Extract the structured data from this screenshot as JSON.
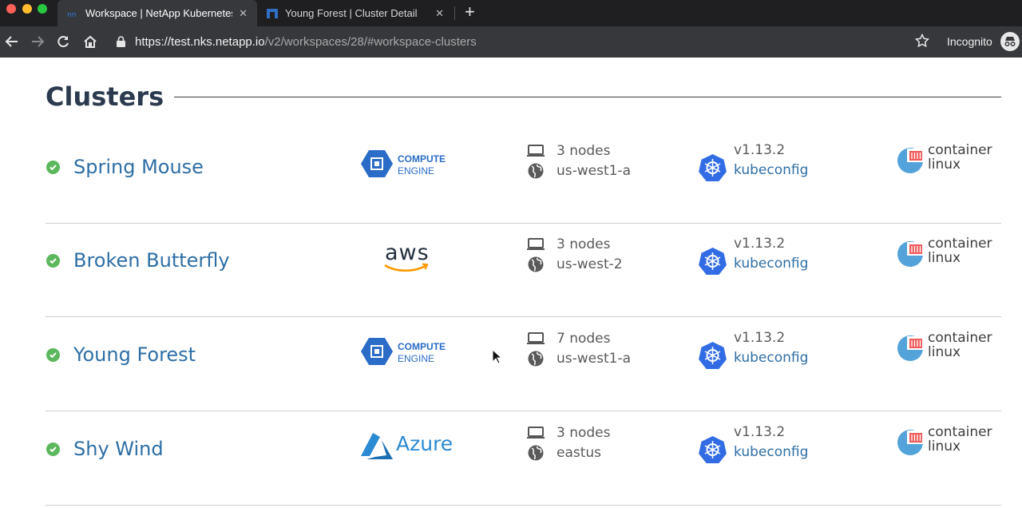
{
  "browser": {
    "tabs": [
      {
        "title": "Workspace | NetApp Kubernetes",
        "active": true
      },
      {
        "title": "Young Forest | Cluster Detail",
        "active": false
      }
    ],
    "url_host": "https://test.nks.netapp.io",
    "url_path": "/v2/workspaces/28/#workspace-clusters",
    "incognito_label": "Incognito"
  },
  "page": {
    "title": "Clusters"
  },
  "clusters": [
    {
      "name": "Spring Mouse",
      "provider": "compute-engine",
      "provider_line1": "COMPUTE",
      "provider_line2": "ENGINE",
      "nodes": "3 nodes",
      "region": "us-west1-a",
      "version": "v1.13.2",
      "kubeconfig": "kubeconfig",
      "os_line1": "container",
      "os_line2": "linux"
    },
    {
      "name": "Broken Butterfly",
      "provider": "aws",
      "provider_line1": "aws",
      "nodes": "3 nodes",
      "region": "us-west-2",
      "version": "v1.13.2",
      "kubeconfig": "kubeconfig",
      "os_line1": "container",
      "os_line2": "linux"
    },
    {
      "name": "Young Forest",
      "provider": "compute-engine",
      "provider_line1": "COMPUTE",
      "provider_line2": "ENGINE",
      "nodes": "7 nodes",
      "region": "us-west1-a",
      "version": "v1.13.2",
      "kubeconfig": "kubeconfig",
      "os_line1": "container",
      "os_line2": "linux"
    },
    {
      "name": "Shy Wind",
      "provider": "azure",
      "provider_line1": "Azure",
      "nodes": "3 nodes",
      "region": "eastus",
      "version": "v1.13.2",
      "kubeconfig": "kubeconfig",
      "os_line1": "container",
      "os_line2": "linux"
    }
  ],
  "colors": {
    "status_ok": "#5cb85c",
    "link": "#2e6ea6",
    "k8s": "#326ce5",
    "compute_engine": "#2a6cc7",
    "azure": "#2a8ad4",
    "aws_smile": "#ff9900",
    "container_linux_blue": "#53a3da",
    "container_linux_red": "#f05a5a"
  }
}
